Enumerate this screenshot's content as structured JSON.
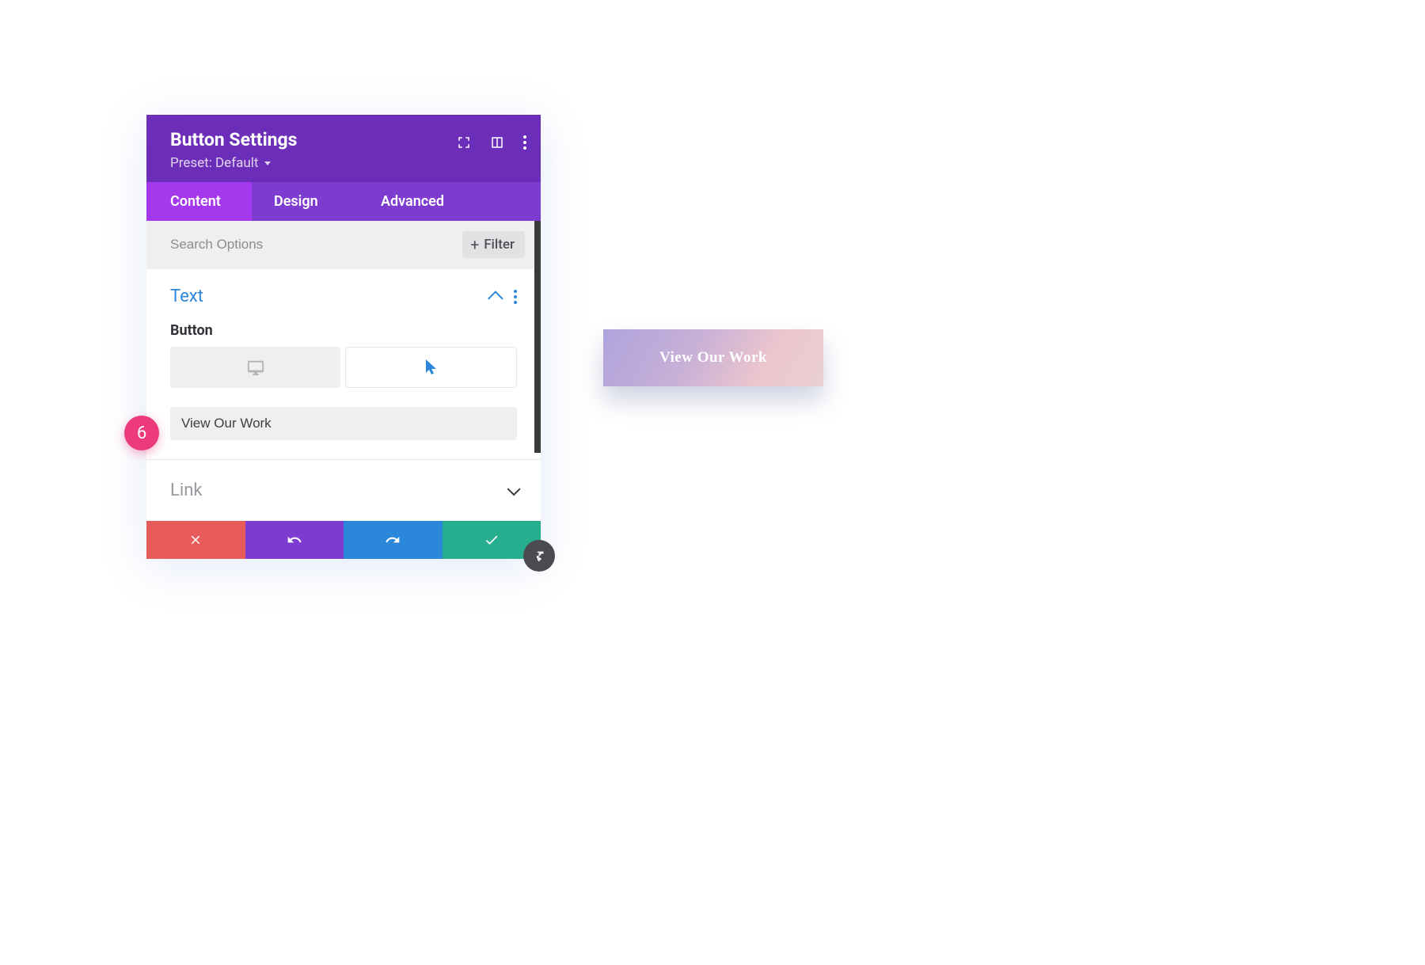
{
  "panel": {
    "title": "Button Settings",
    "preset_label": "Preset: Default"
  },
  "tabs": {
    "content": "Content",
    "design": "Design",
    "advanced": "Advanced"
  },
  "search": {
    "placeholder": "Search Options",
    "filter_label": "Filter"
  },
  "sections": {
    "text": {
      "title": "Text",
      "button_field_label": "Button",
      "button_text_value": "View Our Work"
    },
    "link": {
      "title": "Link"
    }
  },
  "step_badge": "6",
  "preview_button_label": "View Our Work"
}
